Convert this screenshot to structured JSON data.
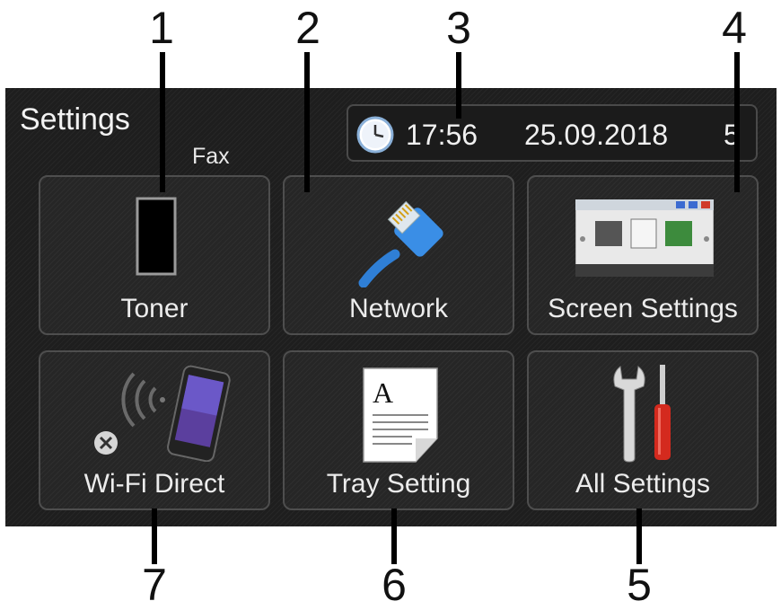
{
  "callouts": [
    "1",
    "2",
    "3",
    "4",
    "5",
    "6",
    "7"
  ],
  "header": {
    "title": "Settings",
    "mode_label": "Fax",
    "time": "17:56",
    "date": "25.09.2018",
    "overflow_char": "5"
  },
  "tiles": [
    {
      "label": "Toner",
      "icon": "toner-icon"
    },
    {
      "label": "Network",
      "icon": "network-cable-icon"
    },
    {
      "label": "Screen Settings",
      "icon": "screen-preview-icon"
    },
    {
      "label": "Wi-Fi Direct",
      "icon": "smartphone-wifi-icon"
    },
    {
      "label": "Tray Setting",
      "icon": "paper-document-icon"
    },
    {
      "label": "All Settings",
      "icon": "tools-icon"
    }
  ],
  "wifi_direct_status": "disconnected",
  "colors": {
    "screen_bg": "#1e1e1e",
    "tile_border": "#4e4e4e",
    "text": "#ececec"
  }
}
